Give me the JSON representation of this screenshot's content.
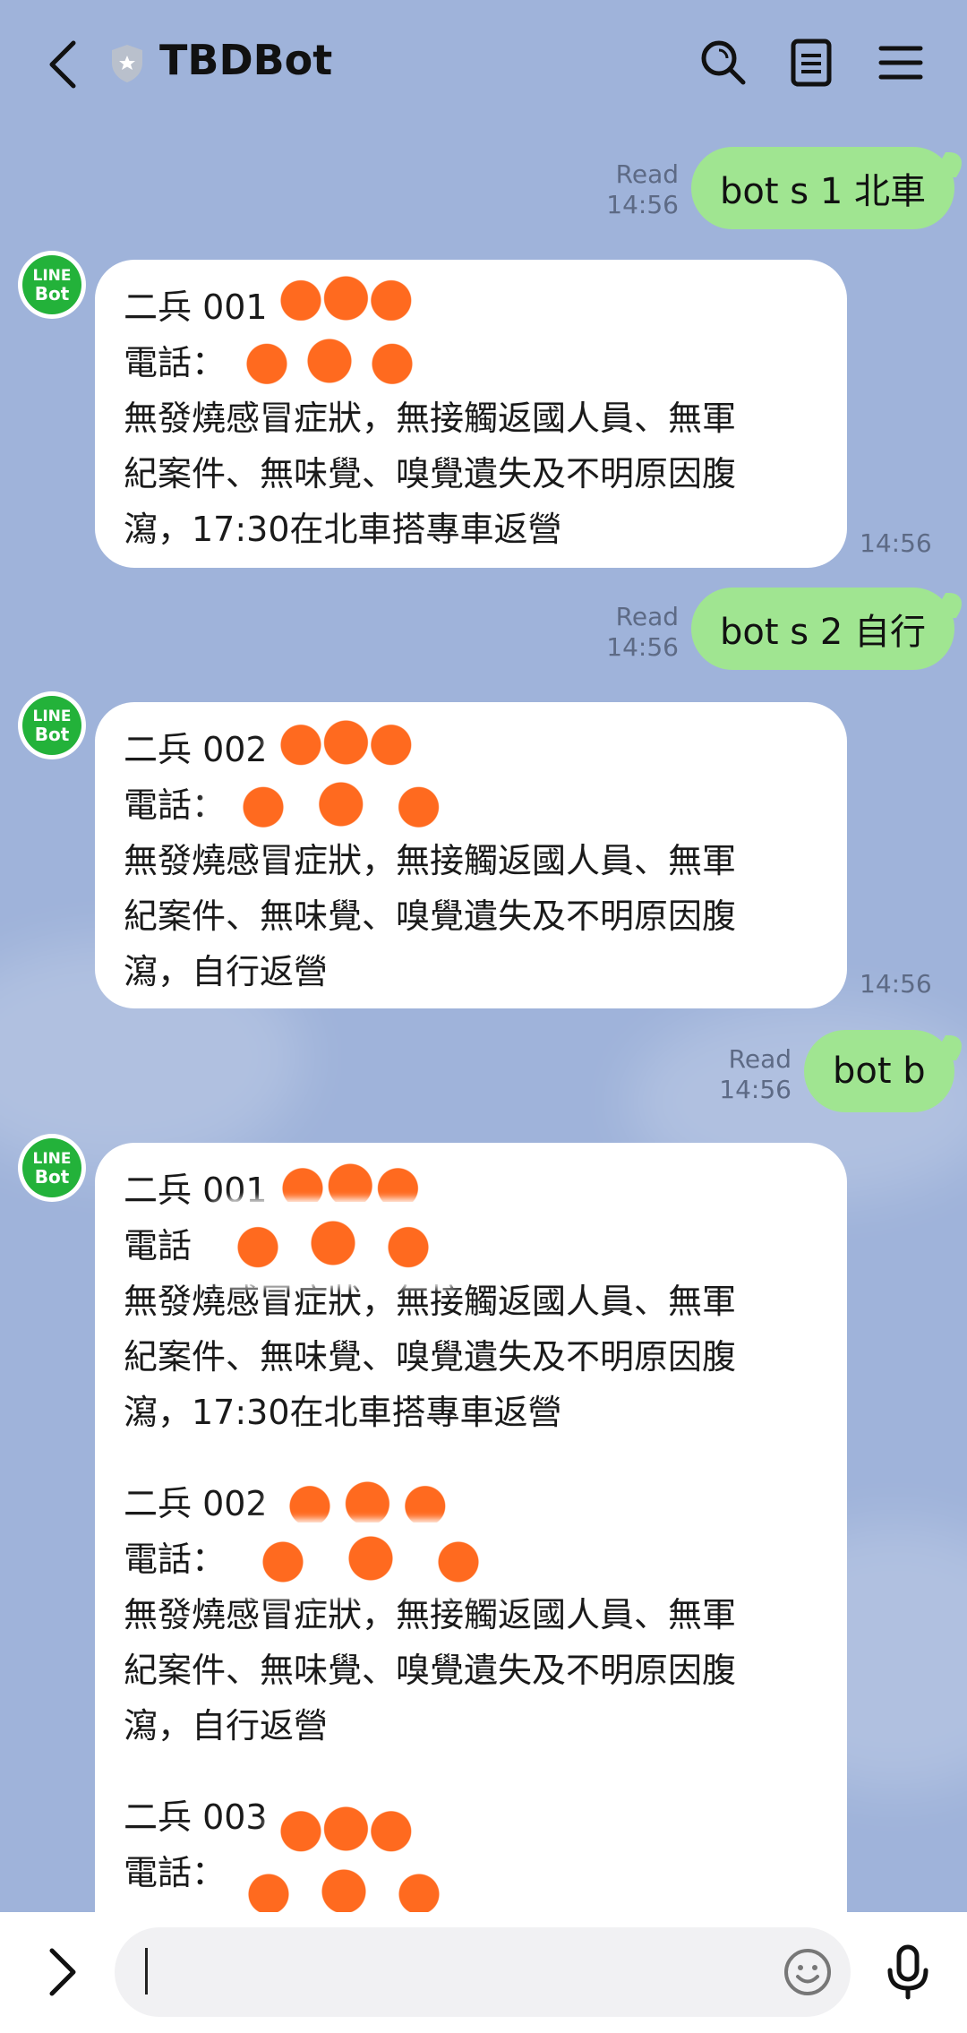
{
  "header": {
    "title": "TBDBot"
  },
  "messages": [
    {
      "type": "out",
      "text": "bot s 1 北車",
      "read": "Read",
      "time": "14:56"
    },
    {
      "type": "in",
      "avatar_line1": "LINE",
      "avatar_line2": "Bot",
      "blocks": [
        "二兵 001 \n電話：\n無發燒感冒症狀，無接觸返國人員、無軍\n紀案件、無味覺、嗅覺遺失及不明原因腹\n瀉，17:30在北車搭專車返營"
      ],
      "time": "14:56"
    },
    {
      "type": "out",
      "text": "bot s 2 自行",
      "read": "Read",
      "time": "14:56"
    },
    {
      "type": "in",
      "avatar_line1": "LINE",
      "avatar_line2": "Bot",
      "blocks": [
        "二兵 002\n電話：\n無發燒感冒症狀，無接觸返國人員、無軍\n紀案件、無味覺、嗅覺遺失及不明原因腹\n瀉，自行返營"
      ],
      "time": "14:56"
    },
    {
      "type": "out",
      "text": "bot b",
      "read": "Read",
      "time": "14:56"
    },
    {
      "type": "in",
      "avatar_line1": "LINE",
      "avatar_line2": "Bot",
      "blocks": [
        "二兵 001 \n電話\n無發燒感冒症狀，無接觸返國人員、無軍\n紀案件、無味覺、嗅覺遺失及不明原因腹\n瀉，17:30在北車搭專車返營",
        "二兵 002\n電話：\n無發燒感冒症狀，無接觸返國人員、無軍\n紀案件、無味覺、嗅覺遺失及不明原因腹\n瀉，自行返營",
        "二兵 003\n電話："
      ]
    }
  ],
  "input": {
    "placeholder": ""
  },
  "icons": [
    "back-icon",
    "shield-icon",
    "search-icon",
    "notes-icon",
    "menu-icon",
    "expand-icon",
    "emoji-icon",
    "mic-icon"
  ]
}
